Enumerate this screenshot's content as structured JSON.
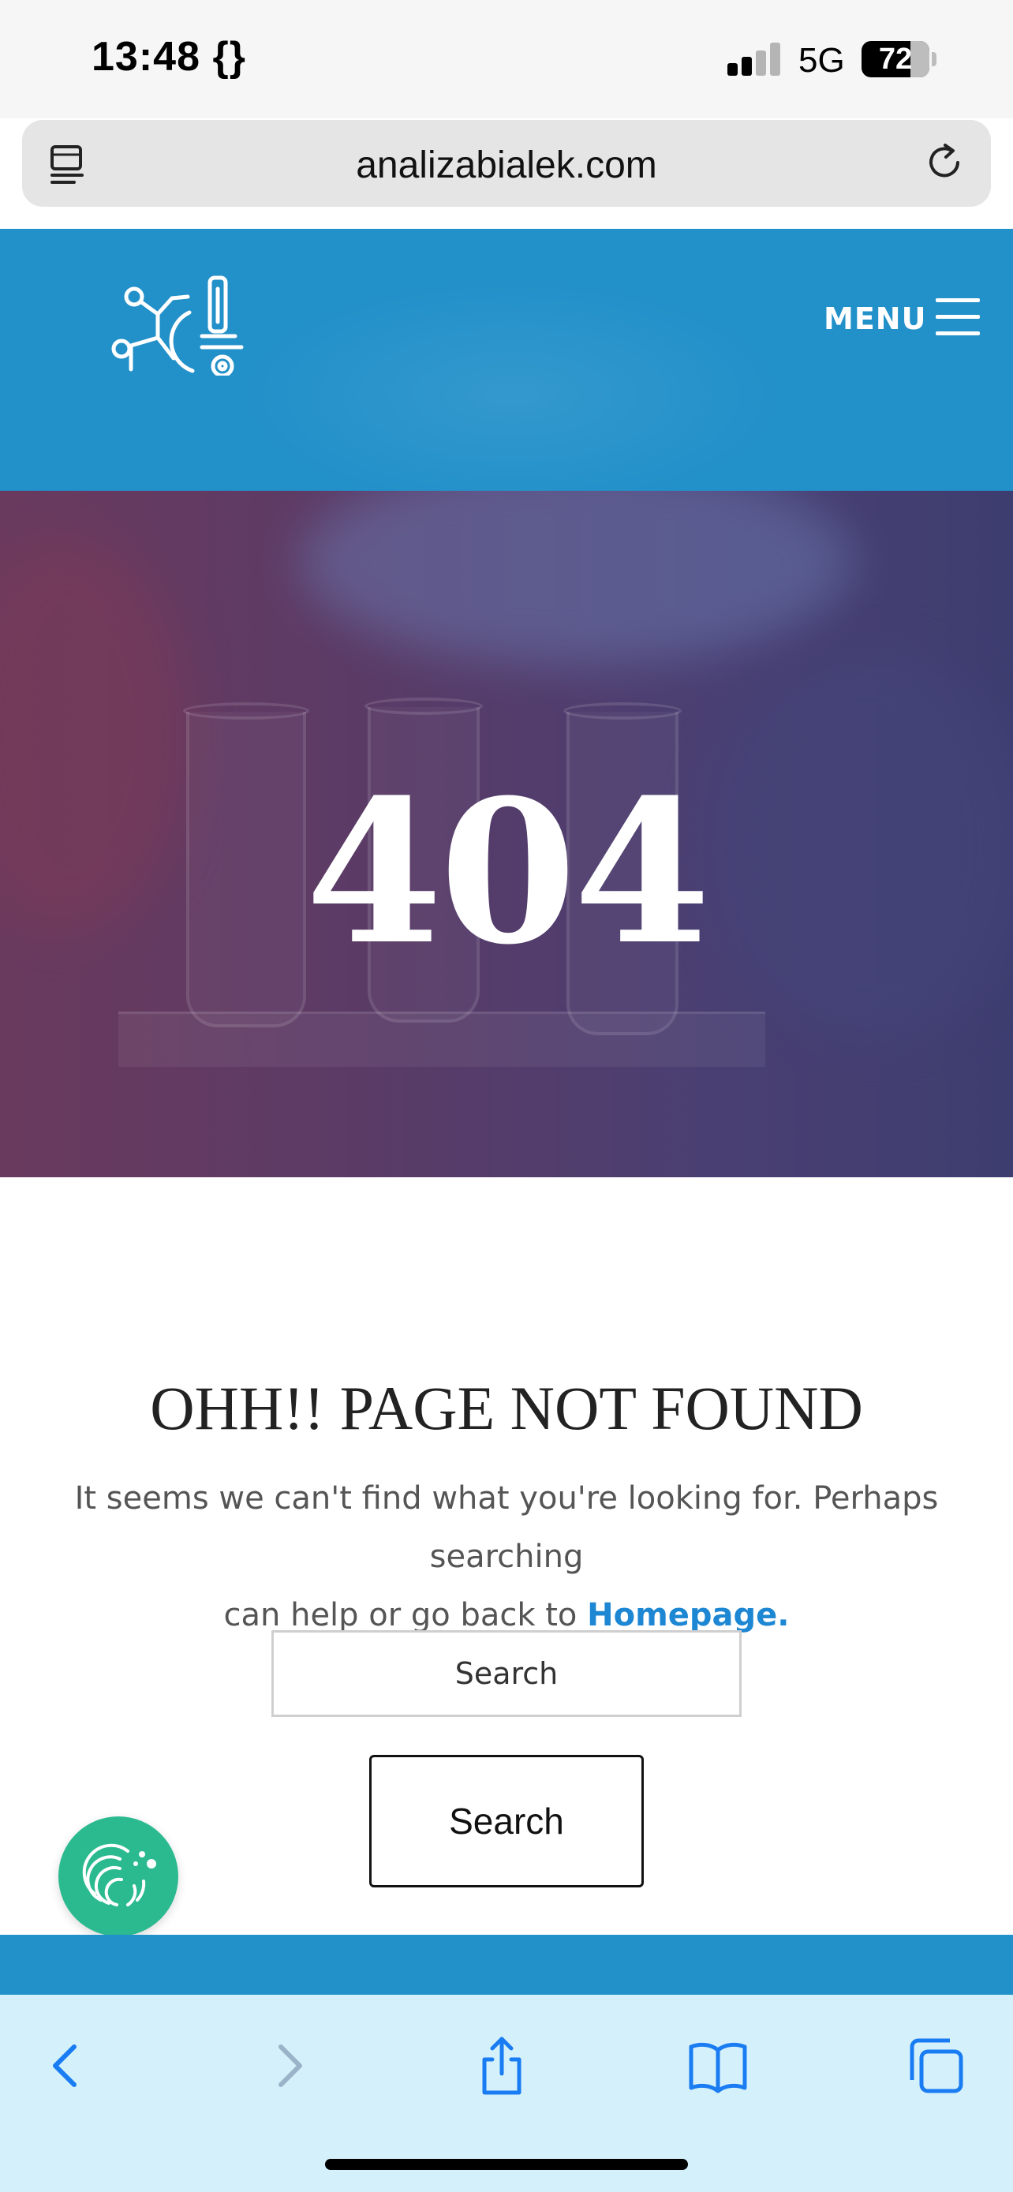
{
  "status_bar": {
    "time": "13:48",
    "time_extra": "{}",
    "network": "5G",
    "battery": "72"
  },
  "browser": {
    "url": "analizabialek.com"
  },
  "header": {
    "menu_label": "MENU",
    "brand_color": "#2290c9"
  },
  "hero": {
    "title": "404"
  },
  "content": {
    "heading": "OHH!! PAGE NOT FOUND",
    "message_line1": "It seems we can't find what you're looking for. Perhaps searching",
    "message_line2": "can help or go back to",
    "home_link": "Homepage.",
    "link_color": "#1d87d3",
    "search_placeholder": "Search",
    "search_button": "Search"
  },
  "cookie_badge": {
    "icon": "fingerprint-cookie-icon",
    "color": "#2bba8f"
  },
  "toolbar": {
    "icons": [
      "back-icon",
      "forward-icon",
      "share-icon",
      "bookmarks-icon",
      "tabs-icon"
    ]
  }
}
